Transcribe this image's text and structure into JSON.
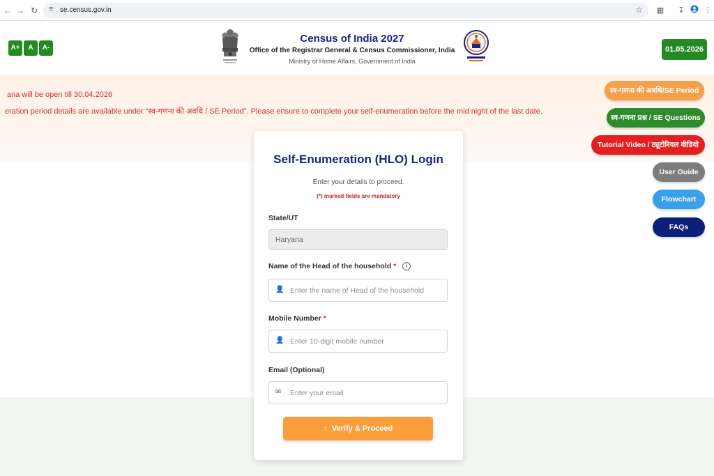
{
  "browser": {
    "url": "se.census.gov.in"
  },
  "header": {
    "font_buttons": [
      "A+",
      "A",
      "A-"
    ],
    "title": "Census of India 2027",
    "subtitle": "Office of the Registrar General & Census Commissioner, India",
    "ministry": "Ministry of Home Affairs, Government of India",
    "date": "01.05.2026"
  },
  "notices": {
    "line1": "ana will be open till 30.04.2026",
    "line2": "eration period details are available under “स्व-गणना की अवधि / SE Period”. Please ensure to complete your self-enumeration before the mid night of the last date."
  },
  "side_menu": [
    {
      "label": "स्व-गणना की अवधि/SE Period",
      "color": "#f5a04a"
    },
    {
      "label": "स्व-गणना प्रश्न / SE Questions",
      "color": "#2e8b2e"
    },
    {
      "label": "Tutorial Video / ट्यूटोरियल वीडियो",
      "color": "#e51f1f"
    },
    {
      "label": "User Guide",
      "color": "#7d7d7d"
    },
    {
      "label": "Flowchart",
      "color": "#3aa0ec"
    },
    {
      "label": "FAQs",
      "color": "#0b1f7a"
    }
  ],
  "form": {
    "title": "Self-Enumeration (HLO) Login",
    "subtitle": "Enter your details to proceed.",
    "mandatory_note": "(*) marked fields are mandatory",
    "state_label": "State/UT",
    "state_value": "Haryana",
    "head_label": "Name of the Head of the household",
    "head_placeholder": "Enter the name of Head of the household",
    "mobile_label": "Mobile Number",
    "mobile_placeholder": "Enter 10-digit mobile number",
    "email_label": "Email (Optional)",
    "email_placeholder": "Enter your email",
    "required_mark": "*",
    "submit_label": "Verify & Proceed"
  }
}
